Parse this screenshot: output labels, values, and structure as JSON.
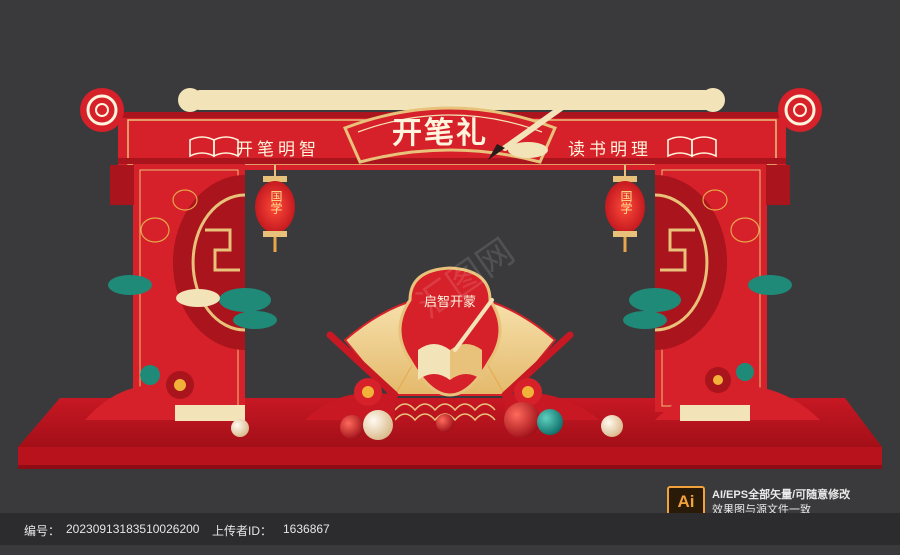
{
  "header": {
    "title": "开笔礼"
  },
  "banner": {
    "left": "开笔明智",
    "right": "读书明理"
  },
  "lanterns": {
    "left": "国学",
    "right": "国学"
  },
  "center_emblem": {
    "text": "启智开蒙"
  },
  "watermark": {
    "text": "汇图网"
  },
  "format_badge": {
    "label": "Ai"
  },
  "format_info": {
    "line1": "AI/EPS全部矢量/可随意修改",
    "line2": "效果图与源文件一致"
  },
  "footer": {
    "id_label": "编号：",
    "id_value": "20230913183510026200",
    "uploader_label": "上传者ID：",
    "uploader_value": "1636867"
  },
  "colors": {
    "background": "#3a3a3c",
    "red": "#d6202a",
    "dark_red": "#a9141d",
    "gold": "#e8c27a",
    "cream": "#f3e3b8"
  }
}
